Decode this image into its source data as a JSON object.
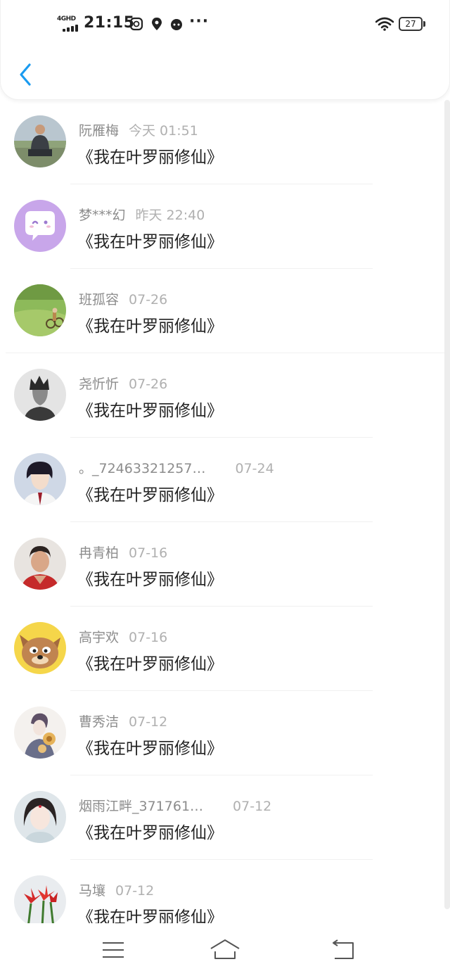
{
  "status_bar": {
    "network": "4GHD",
    "time": "21:15",
    "battery": "27",
    "icons": [
      "message-icon",
      "location-icon",
      "avatar-face-icon",
      "more-dots-icon",
      "wifi-icon",
      "battery-icon"
    ],
    "more": "···"
  },
  "header": {
    "back_icon": "chevron-left-icon",
    "accent": "#1a9bf0"
  },
  "items": [
    {
      "name": "阮雁梅",
      "date": "今天 01:51",
      "title": "《我在叶罗丽修仙》",
      "avatar": "photo-person-outdoors"
    },
    {
      "name": "梦***幻",
      "date": "昨天 22:40",
      "title": "《我在叶罗丽修仙》",
      "avatar": "purple-chat-bubble"
    },
    {
      "name": "班孤容",
      "date": "07-26",
      "title": "《我在叶罗丽修仙》",
      "avatar": "grass-field-bicycle"
    },
    {
      "name": "尧忻忻",
      "date": "07-26",
      "title": "《我在叶罗丽修仙》",
      "avatar": "dark-anime-man"
    },
    {
      "name": "。_72463321257…",
      "date": "07-24",
      "title": "《我在叶罗丽修仙》",
      "avatar": "anime-boy"
    },
    {
      "name": "冉青柏",
      "date": "07-16",
      "title": "《我在叶罗丽修仙》",
      "avatar": "photo-woman"
    },
    {
      "name": "高宇欢",
      "date": "07-16",
      "title": "《我在叶罗丽修仙》",
      "avatar": "cartoon-cat"
    },
    {
      "name": "曹秀洁",
      "date": "07-12",
      "title": "《我在叶罗丽修仙》",
      "avatar": "anime-girl-flowers"
    },
    {
      "name": "烟雨江畔_371761…",
      "date": "07-12",
      "title": "《我在叶罗丽修仙》",
      "avatar": "anime-lady"
    },
    {
      "name": "马壤",
      "date": "07-12",
      "title": "《我在叶罗丽修仙》",
      "avatar": "red-lily-flowers"
    }
  ],
  "nav_bar": {
    "menu_icon": "menu-icon",
    "home_icon": "home-icon",
    "back_icon": "back-arrow-icon"
  }
}
